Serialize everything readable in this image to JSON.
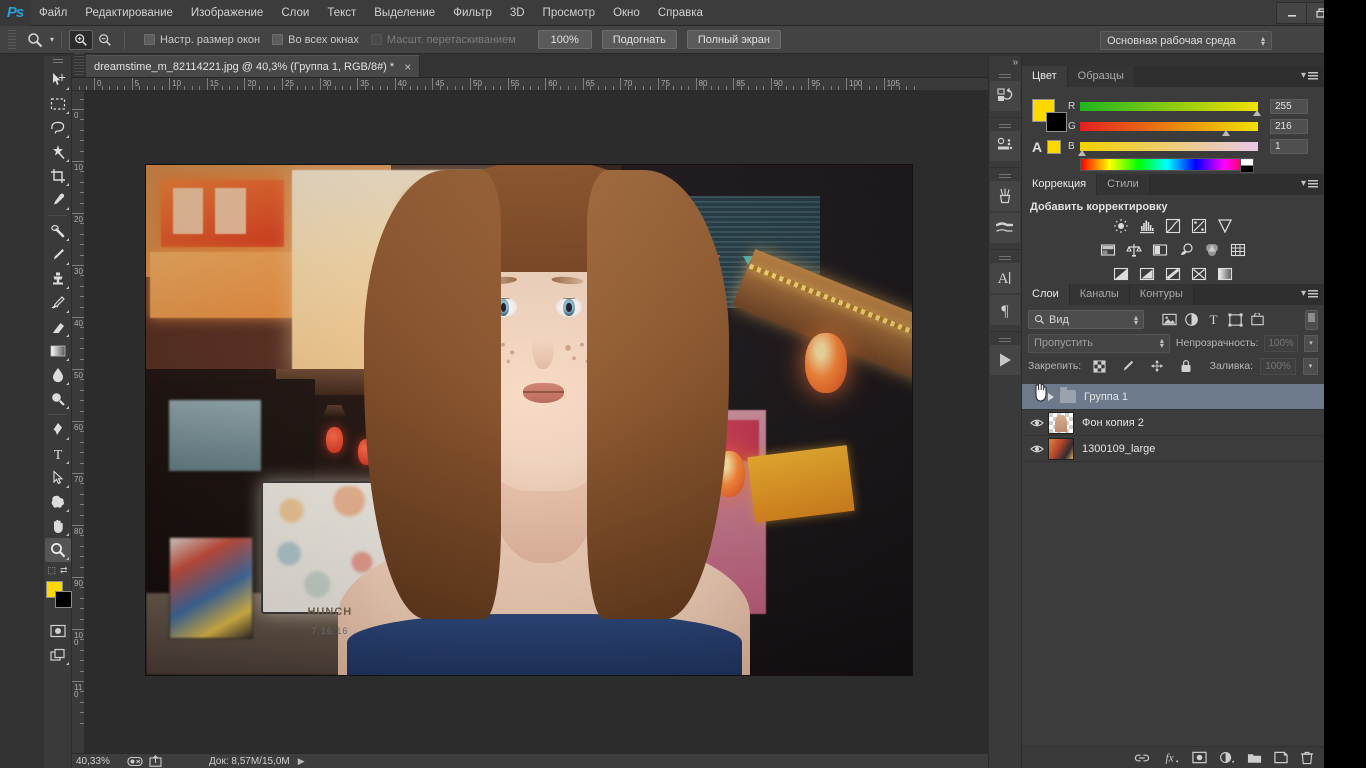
{
  "app": {
    "logo": "Ps",
    "name": "Adobe Photoshop"
  },
  "menu": {
    "items": [
      {
        "label": "Файл"
      },
      {
        "label": "Редактирование"
      },
      {
        "label": "Изображение"
      },
      {
        "label": "Слои"
      },
      {
        "label": "Текст"
      },
      {
        "label": "Выделение"
      },
      {
        "label": "Фильтр"
      },
      {
        "label": "3D"
      },
      {
        "label": "Просмотр"
      },
      {
        "label": "Окно"
      },
      {
        "label": "Справка"
      }
    ]
  },
  "window_controls": {
    "minimize": "—",
    "restore": "❐",
    "close": "✕"
  },
  "options_bar": {
    "tool_icon": "zoom-tool-icon",
    "zoom_in_icon": "zoom-in-icon",
    "zoom_out_icon": "zoom-out-icon",
    "checkboxes": [
      {
        "label": "Настр. размер окон",
        "checked": false,
        "disabled": false
      },
      {
        "label": "Во всех окнах",
        "checked": false,
        "disabled": false
      },
      {
        "label": "Масшт. перетаскиванием",
        "checked": false,
        "disabled": true
      }
    ],
    "buttons": [
      {
        "label": "100%"
      },
      {
        "label": "Подогнать"
      },
      {
        "label": "Полный экран"
      }
    ],
    "workspace": "Основная рабочая среда"
  },
  "toolbar": {
    "tools": [
      {
        "name": "move-tool",
        "icon": "move-icon"
      },
      {
        "name": "rectangular-marquee-tool",
        "icon": "marquee-icon"
      },
      {
        "name": "lasso-tool",
        "icon": "lasso-icon"
      },
      {
        "name": "magic-wand-tool",
        "icon": "wand-icon"
      },
      {
        "name": "crop-tool",
        "icon": "crop-icon"
      },
      {
        "name": "eyedropper-tool",
        "icon": "eyedropper-icon"
      },
      {
        "name": "spot-healing-brush-tool",
        "icon": "healing-icon"
      },
      {
        "name": "brush-tool",
        "icon": "brush-icon"
      },
      {
        "name": "clone-stamp-tool",
        "icon": "stamp-icon"
      },
      {
        "name": "history-brush-tool",
        "icon": "history-brush-icon"
      },
      {
        "name": "eraser-tool",
        "icon": "eraser-icon"
      },
      {
        "name": "gradient-tool",
        "icon": "gradient-icon"
      },
      {
        "name": "blur-tool",
        "icon": "blur-drop-icon"
      },
      {
        "name": "dodge-tool",
        "icon": "dodge-icon"
      },
      {
        "name": "pen-tool",
        "icon": "pen-icon"
      },
      {
        "name": "horizontal-type-tool",
        "icon": "type-icon"
      },
      {
        "name": "path-selection-tool",
        "icon": "path-arrow-icon"
      },
      {
        "name": "custom-shape-tool",
        "icon": "shape-icon"
      },
      {
        "name": "hand-tool",
        "icon": "hand-icon"
      },
      {
        "name": "zoom-tool",
        "icon": "zoom-icon",
        "selected": true
      }
    ],
    "foreground_color": "#ffd800",
    "background_color": "#000000",
    "quick_mask_icon": "quick-mask-icon",
    "screen_mode_icon": "screen-mode-icon"
  },
  "document": {
    "tab_title": "dreamstime_m_82114221.jpg @ 40,3% (Группа 1, RGB/8#) *",
    "close_label": "×",
    "h_ruler_ticks": [
      "5",
      "0",
      "5",
      "10",
      "15",
      "20",
      "25",
      "30",
      "35",
      "40",
      "45",
      "50",
      "55",
      "60",
      "65",
      "70",
      "75",
      "80",
      "85",
      "90",
      "95",
      "100",
      "105"
    ],
    "v_ruler_ticks": [
      "10",
      "0",
      "10",
      "20",
      "30",
      "40",
      "50",
      "60",
      "70",
      "80",
      "90",
      "100",
      "110"
    ],
    "image": {
      "alt": "Portrait of a young red-haired woman on a neon-lit Asian street at night",
      "sign_title": "HUNCH",
      "sign_date": "7.16.16"
    }
  },
  "status_bar": {
    "zoom": "40,33%",
    "doc_info": "Док: 8,57M/15,0M",
    "arrow": "▶"
  },
  "icon_dock": {
    "collapse": "»",
    "items": [
      {
        "name": "history-panel-icon",
        "label": "История"
      },
      {
        "name": "properties-panel-icon",
        "label": "Свойства"
      },
      {
        "name": "brush-panel-icon",
        "label": "Кисть"
      },
      {
        "name": "brush-presets-panel-icon",
        "label": "Наборы кистей"
      },
      {
        "name": "character-panel-icon",
        "label": "Символ"
      },
      {
        "name": "paragraph-panel-icon",
        "label": "Абзац"
      },
      {
        "name": "timeline-panel-icon",
        "label": "Шкала времени"
      }
    ]
  },
  "color_panel": {
    "tabs": [
      {
        "label": "Цвет",
        "active": true
      },
      {
        "label": "Образцы",
        "active": false
      }
    ],
    "menu_icon": "panel-menu-icon",
    "alpha_label": "A",
    "channels": [
      {
        "label": "R",
        "value": "255",
        "pos": 99
      },
      {
        "label": "G",
        "value": "216",
        "pos": 84
      },
      {
        "label": "B",
        "value": "1",
        "pos": 1
      }
    ],
    "foreground": "#ffd800",
    "background": "#000000"
  },
  "adjustments_panel": {
    "tabs": [
      {
        "label": "Коррекция",
        "active": true
      },
      {
        "label": "Стили",
        "active": false
      }
    ],
    "heading": "Добавить корректировку",
    "rows": [
      [
        {
          "name": "brightness-contrast-icon"
        },
        {
          "name": "levels-icon"
        },
        {
          "name": "curves-icon"
        },
        {
          "name": "exposure-icon"
        },
        {
          "name": "vibrance-icon"
        }
      ],
      [
        {
          "name": "hue-saturation-icon"
        },
        {
          "name": "color-balance-icon"
        },
        {
          "name": "black-white-icon"
        },
        {
          "name": "photo-filter-icon"
        },
        {
          "name": "channel-mixer-icon"
        },
        {
          "name": "color-lookup-icon"
        }
      ],
      [
        {
          "name": "invert-icon"
        },
        {
          "name": "posterize-icon"
        },
        {
          "name": "threshold-icon"
        },
        {
          "name": "selective-color-icon"
        },
        {
          "name": "gradient-map-icon"
        }
      ]
    ]
  },
  "layers_panel": {
    "tabs": [
      {
        "label": "Слои",
        "active": true
      },
      {
        "label": "Каналы",
        "active": false
      },
      {
        "label": "Контуры",
        "active": false
      }
    ],
    "menu_icon": "panel-menu-icon",
    "filter": {
      "search_icon": "search-icon",
      "kind_value": "Вид",
      "filter_icons": [
        {
          "name": "filter-pixel-icon"
        },
        {
          "name": "filter-adjustment-icon"
        },
        {
          "name": "filter-type-icon"
        },
        {
          "name": "filter-shape-icon"
        },
        {
          "name": "filter-smart-object-icon"
        }
      ],
      "toggle_name": "filter-enable-toggle"
    },
    "blend_mode": "Пропустить",
    "opacity_label": "Непрозрачность:",
    "opacity_value": "100%",
    "lock_label": "Закрепить:",
    "lock_icons": [
      {
        "name": "lock-transparent-pixels-icon"
      },
      {
        "name": "lock-image-pixels-icon"
      },
      {
        "name": "lock-position-icon"
      },
      {
        "name": "lock-all-icon"
      }
    ],
    "fill_label": "Заливка:",
    "fill_value": "100%",
    "layers": [
      {
        "name": "Группа 1",
        "type": "group",
        "visible": false,
        "selected": true,
        "expand_icon": "triangle-right-icon"
      },
      {
        "name": "Фон копия 2",
        "type": "pixel",
        "visible": true,
        "selected": false
      },
      {
        "name": "1300109_large",
        "type": "pixel",
        "visible": true,
        "selected": false
      }
    ],
    "bottom_buttons": [
      {
        "name": "link-layers-button",
        "icon": "link-icon"
      },
      {
        "name": "layer-style-button",
        "icon": "fx-icon"
      },
      {
        "name": "add-layer-mask-button",
        "icon": "mask-icon"
      },
      {
        "name": "new-adjustment-layer-button",
        "icon": "half-circle-icon"
      },
      {
        "name": "new-group-button",
        "icon": "folder-icon"
      },
      {
        "name": "new-layer-button",
        "icon": "new-layer-icon"
      },
      {
        "name": "delete-layer-button",
        "icon": "trash-icon"
      }
    ]
  }
}
